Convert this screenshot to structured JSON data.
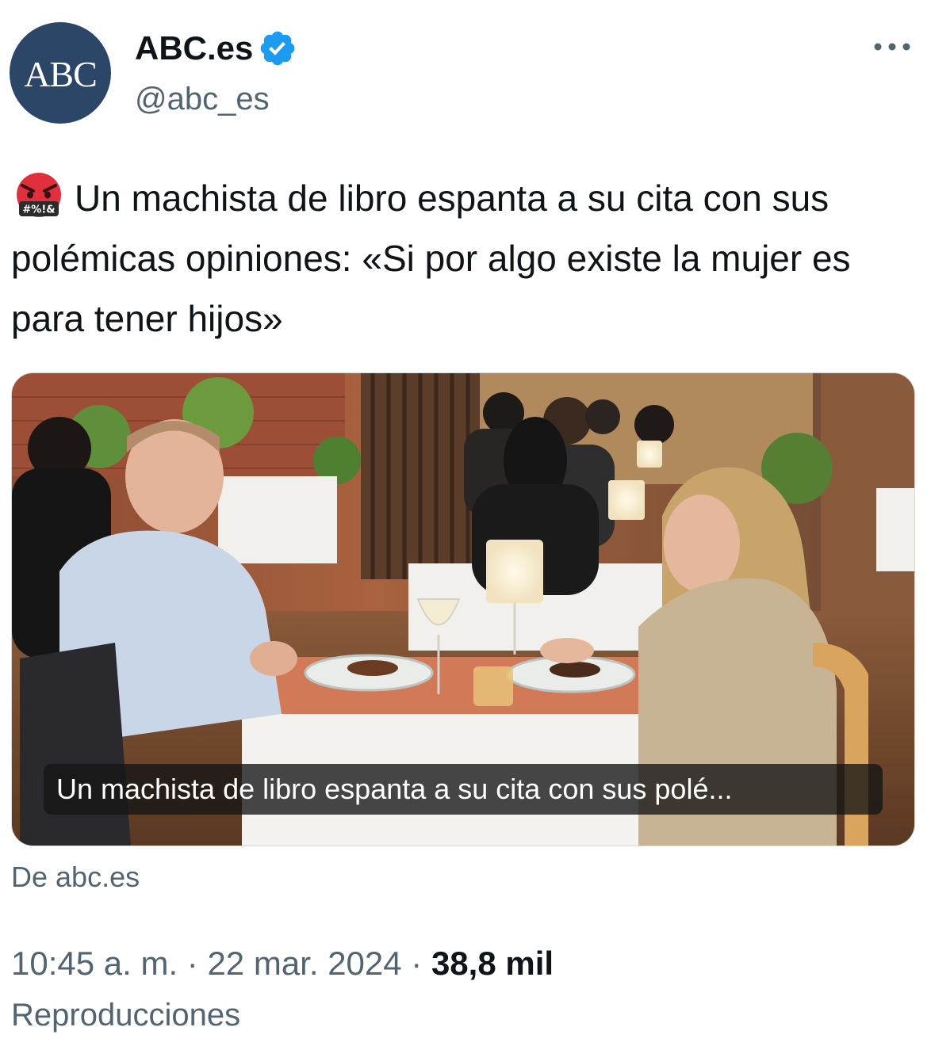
{
  "account": {
    "avatar_text": "ABC",
    "name": "ABC.es",
    "handle": "@abc_es",
    "verified": true,
    "avatar_color": "#2c4668",
    "verified_color": "#1d9bf0"
  },
  "more_icon": "more-horizontal-icon",
  "tweet": {
    "emoji": "angry-face-with-symbols-icon",
    "emoji_symbols": "#%!&",
    "text": "Un machista de libro espanta a su cita con sus polémicas opiniones: «Si por algo existe la mujer es para tener hijos»"
  },
  "media": {
    "caption": "Un machista de libro espanta a su cita con sus polé..."
  },
  "card": {
    "source": "De abc.es"
  },
  "meta": {
    "time": "10:45 a. m.",
    "separator1": " · ",
    "date": "22 mar. 2024",
    "separator2": " · ",
    "views_count": "38,8 mil",
    "views_label": "Reproducciones"
  }
}
